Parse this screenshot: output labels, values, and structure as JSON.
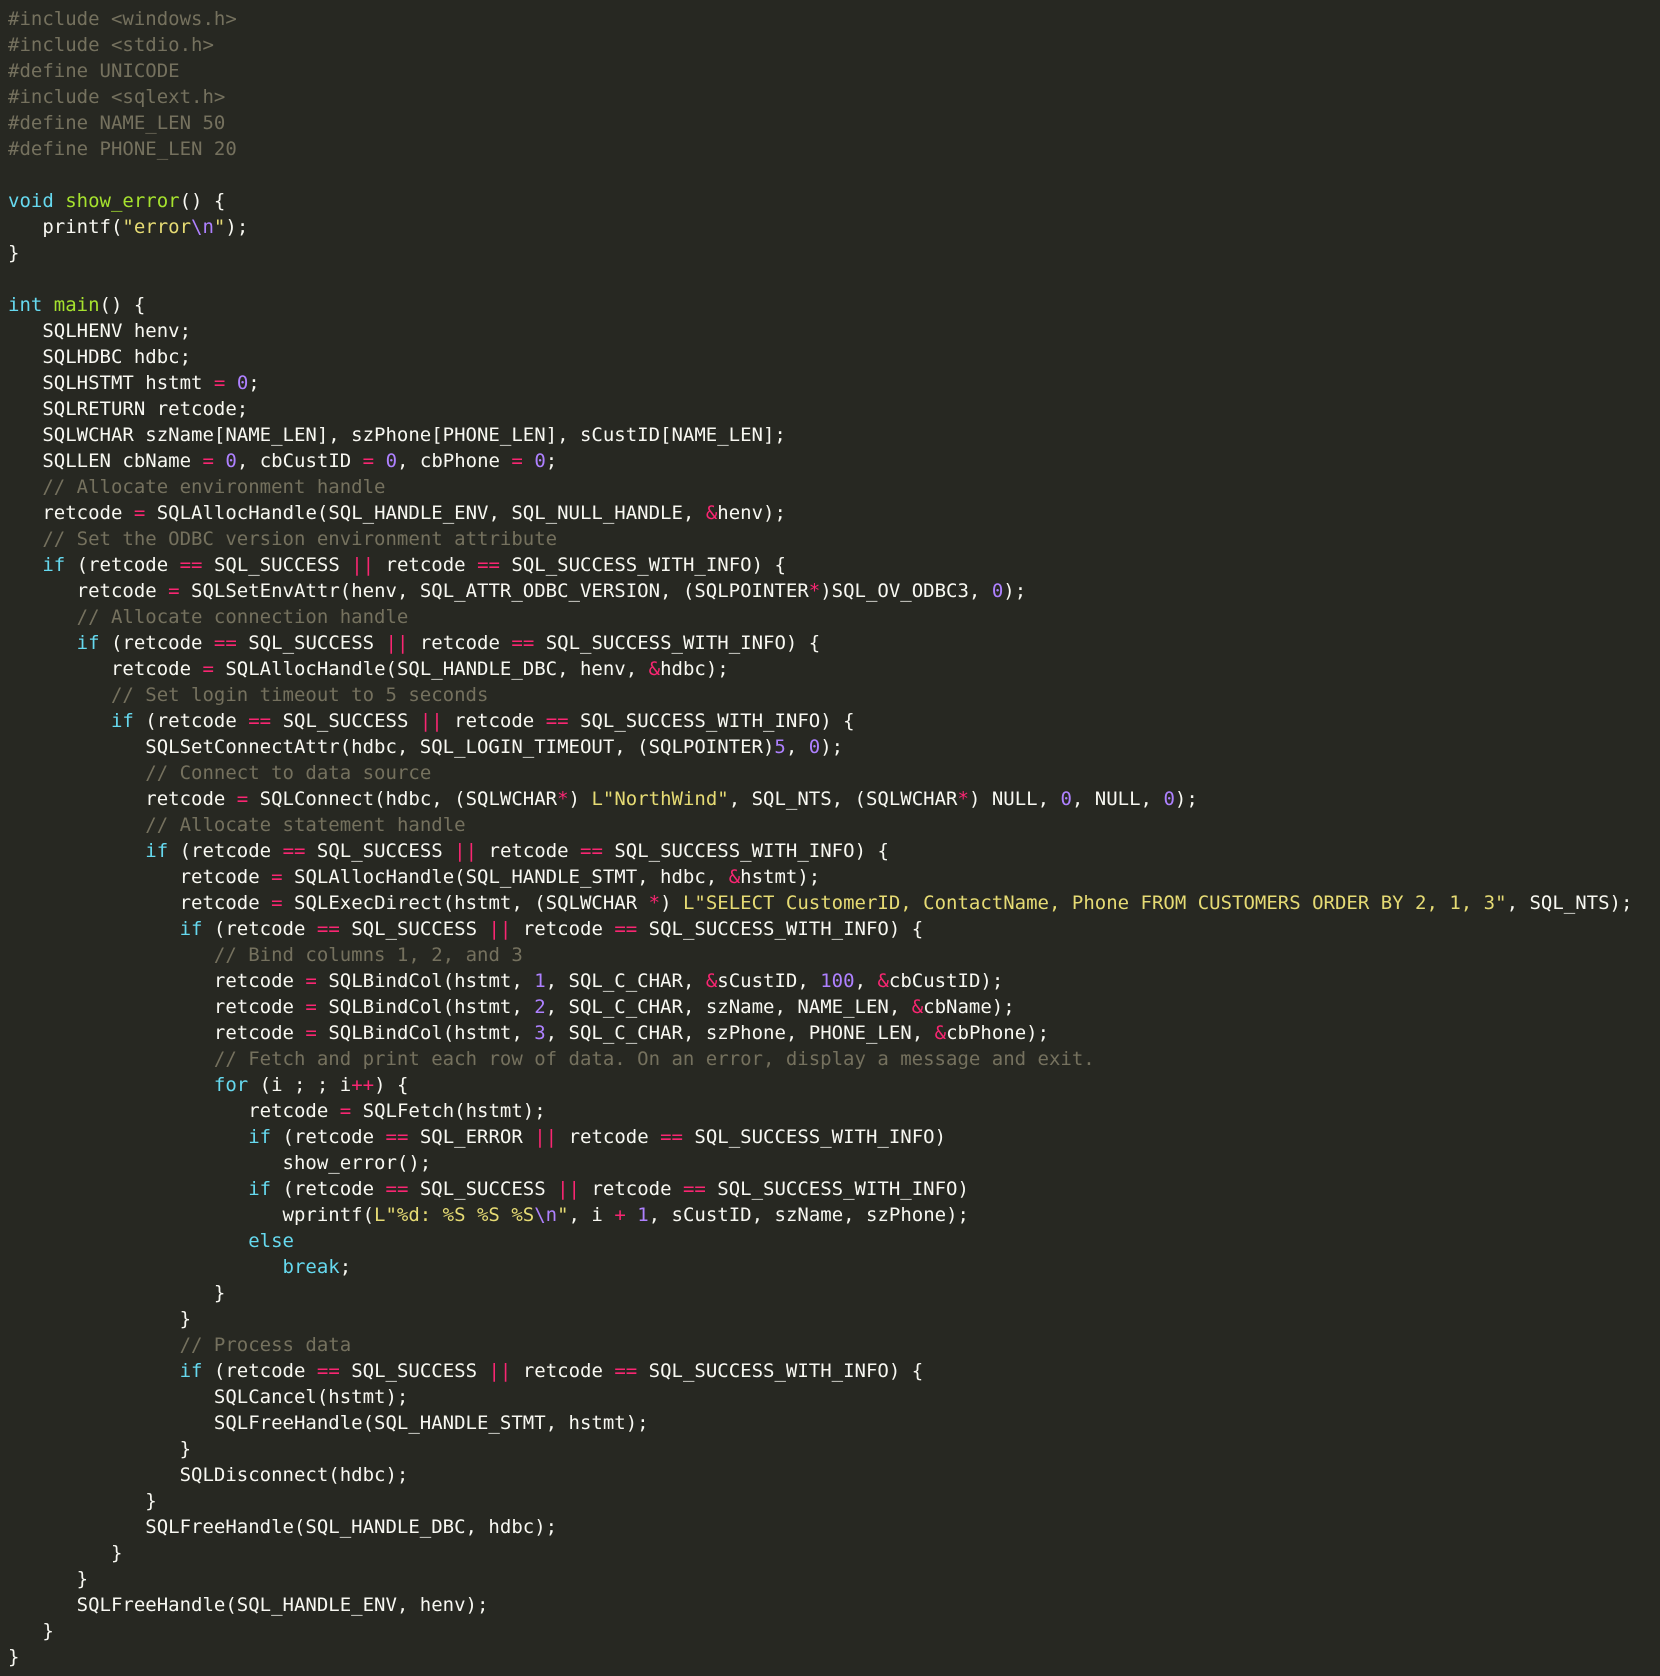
{
  "colors": {
    "background": "#272822",
    "text": "#f8f8f2",
    "comment": "#75715e",
    "keyword": "#66d9ef",
    "function": "#a6e22e",
    "operator": "#f92672",
    "number": "#ae81ff",
    "string": "#e6db74",
    "escape": "#ae81ff"
  },
  "code": {
    "lines": [
      [
        [
          "c",
          "#include <windows.h>"
        ]
      ],
      [
        [
          "c",
          "#include <stdio.h>"
        ]
      ],
      [
        [
          "c",
          "#define UNICODE"
        ]
      ],
      [
        [
          "c",
          "#include <sqlext.h>"
        ]
      ],
      [
        [
          "c",
          "#define NAME_LEN 50"
        ]
      ],
      [
        [
          "c",
          "#define PHONE_LEN 20"
        ]
      ],
      [],
      [
        [
          "k",
          "void"
        ],
        [
          "t",
          " "
        ],
        [
          "f",
          "show_error"
        ],
        [
          "t",
          "() {"
        ]
      ],
      [
        [
          "t",
          "   printf("
        ],
        [
          "s",
          "\"error"
        ],
        [
          "e",
          "\\n"
        ],
        [
          "s",
          "\""
        ],
        [
          "t",
          ");"
        ]
      ],
      [
        [
          "t",
          "}"
        ]
      ],
      [],
      [
        [
          "k",
          "int"
        ],
        [
          "t",
          " "
        ],
        [
          "f",
          "main"
        ],
        [
          "t",
          "() {"
        ]
      ],
      [
        [
          "t",
          "   SQLHENV henv;"
        ]
      ],
      [
        [
          "t",
          "   SQLHDBC hdbc;"
        ]
      ],
      [
        [
          "t",
          "   SQLHSTMT hstmt "
        ],
        [
          "o",
          "="
        ],
        [
          "t",
          " "
        ],
        [
          "n",
          "0"
        ],
        [
          "t",
          ";"
        ]
      ],
      [
        [
          "t",
          "   SQLRETURN retcode;"
        ]
      ],
      [
        [
          "t",
          "   SQLWCHAR szName[NAME_LEN], szPhone[PHONE_LEN], sCustID[NAME_LEN];"
        ]
      ],
      [
        [
          "t",
          "   SQLLEN cbName "
        ],
        [
          "o",
          "="
        ],
        [
          "t",
          " "
        ],
        [
          "n",
          "0"
        ],
        [
          "t",
          ", cbCustID "
        ],
        [
          "o",
          "="
        ],
        [
          "t",
          " "
        ],
        [
          "n",
          "0"
        ],
        [
          "t",
          ", cbPhone "
        ],
        [
          "o",
          "="
        ],
        [
          "t",
          " "
        ],
        [
          "n",
          "0"
        ],
        [
          "t",
          ";"
        ]
      ],
      [
        [
          "t",
          "   "
        ],
        [
          "c",
          "// Allocate environment handle"
        ]
      ],
      [
        [
          "t",
          "   retcode "
        ],
        [
          "o",
          "="
        ],
        [
          "t",
          " SQLAllocHandle(SQL_HANDLE_ENV, SQL_NULL_HANDLE, "
        ],
        [
          "o",
          "&"
        ],
        [
          "t",
          "henv);"
        ]
      ],
      [
        [
          "t",
          "   "
        ],
        [
          "c",
          "// Set the ODBC version environment attribute"
        ]
      ],
      [
        [
          "t",
          "   "
        ],
        [
          "k",
          "if"
        ],
        [
          "t",
          " (retcode "
        ],
        [
          "o",
          "=="
        ],
        [
          "t",
          " SQL_SUCCESS "
        ],
        [
          "o",
          "||"
        ],
        [
          "t",
          " retcode "
        ],
        [
          "o",
          "=="
        ],
        [
          "t",
          " SQL_SUCCESS_WITH_INFO) {"
        ]
      ],
      [
        [
          "t",
          "      retcode "
        ],
        [
          "o",
          "="
        ],
        [
          "t",
          " SQLSetEnvAttr(henv, SQL_ATTR_ODBC_VERSION, (SQLPOINTER"
        ],
        [
          "o",
          "*"
        ],
        [
          "t",
          ")SQL_OV_ODBC3, "
        ],
        [
          "n",
          "0"
        ],
        [
          "t",
          ");"
        ]
      ],
      [
        [
          "t",
          "      "
        ],
        [
          "c",
          "// Allocate connection handle"
        ]
      ],
      [
        [
          "t",
          "      "
        ],
        [
          "k",
          "if"
        ],
        [
          "t",
          " (retcode "
        ],
        [
          "o",
          "=="
        ],
        [
          "t",
          " SQL_SUCCESS "
        ],
        [
          "o",
          "||"
        ],
        [
          "t",
          " retcode "
        ],
        [
          "o",
          "=="
        ],
        [
          "t",
          " SQL_SUCCESS_WITH_INFO) {"
        ]
      ],
      [
        [
          "t",
          "         retcode "
        ],
        [
          "o",
          "="
        ],
        [
          "t",
          " SQLAllocHandle(SQL_HANDLE_DBC, henv, "
        ],
        [
          "o",
          "&"
        ],
        [
          "t",
          "hdbc);"
        ]
      ],
      [
        [
          "t",
          "         "
        ],
        [
          "c",
          "// Set login timeout to 5 seconds"
        ]
      ],
      [
        [
          "t",
          "         "
        ],
        [
          "k",
          "if"
        ],
        [
          "t",
          " (retcode "
        ],
        [
          "o",
          "=="
        ],
        [
          "t",
          " SQL_SUCCESS "
        ],
        [
          "o",
          "||"
        ],
        [
          "t",
          " retcode "
        ],
        [
          "o",
          "=="
        ],
        [
          "t",
          " SQL_SUCCESS_WITH_INFO) {"
        ]
      ],
      [
        [
          "t",
          "            SQLSetConnectAttr(hdbc, SQL_LOGIN_TIMEOUT, (SQLPOINTER)"
        ],
        [
          "n",
          "5"
        ],
        [
          "t",
          ", "
        ],
        [
          "n",
          "0"
        ],
        [
          "t",
          ");"
        ]
      ],
      [
        [
          "t",
          "            "
        ],
        [
          "c",
          "// Connect to data source"
        ]
      ],
      [
        [
          "t",
          "            retcode "
        ],
        [
          "o",
          "="
        ],
        [
          "t",
          " SQLConnect(hdbc, (SQLWCHAR"
        ],
        [
          "o",
          "*"
        ],
        [
          "t",
          ") "
        ],
        [
          "s",
          "L\"NorthWind\""
        ],
        [
          "t",
          ", SQL_NTS, (SQLWCHAR"
        ],
        [
          "o",
          "*"
        ],
        [
          "t",
          ") NULL, "
        ],
        [
          "n",
          "0"
        ],
        [
          "t",
          ", NULL, "
        ],
        [
          "n",
          "0"
        ],
        [
          "t",
          ");"
        ]
      ],
      [
        [
          "t",
          "            "
        ],
        [
          "c",
          "// Allocate statement handle"
        ]
      ],
      [
        [
          "t",
          "            "
        ],
        [
          "k",
          "if"
        ],
        [
          "t",
          " (retcode "
        ],
        [
          "o",
          "=="
        ],
        [
          "t",
          " SQL_SUCCESS "
        ],
        [
          "o",
          "||"
        ],
        [
          "t",
          " retcode "
        ],
        [
          "o",
          "=="
        ],
        [
          "t",
          " SQL_SUCCESS_WITH_INFO) {"
        ]
      ],
      [
        [
          "t",
          "               retcode "
        ],
        [
          "o",
          "="
        ],
        [
          "t",
          " SQLAllocHandle(SQL_HANDLE_STMT, hdbc, "
        ],
        [
          "o",
          "&"
        ],
        [
          "t",
          "hstmt);"
        ]
      ],
      [
        [
          "t",
          "               retcode "
        ],
        [
          "o",
          "="
        ],
        [
          "t",
          " SQLExecDirect(hstmt, (SQLWCHAR "
        ],
        [
          "o",
          "*"
        ],
        [
          "t",
          ") "
        ],
        [
          "s",
          "L\"SELECT CustomerID, ContactName, Phone FROM CUSTOMERS ORDER BY 2, 1, 3\""
        ],
        [
          "t",
          ", SQL_NTS);"
        ]
      ],
      [
        [
          "t",
          "               "
        ],
        [
          "k",
          "if"
        ],
        [
          "t",
          " (retcode "
        ],
        [
          "o",
          "=="
        ],
        [
          "t",
          " SQL_SUCCESS "
        ],
        [
          "o",
          "||"
        ],
        [
          "t",
          " retcode "
        ],
        [
          "o",
          "=="
        ],
        [
          "t",
          " SQL_SUCCESS_WITH_INFO) {"
        ]
      ],
      [
        [
          "t",
          "                  "
        ],
        [
          "c",
          "// Bind columns 1, 2, and 3"
        ]
      ],
      [
        [
          "t",
          "                  retcode "
        ],
        [
          "o",
          "="
        ],
        [
          "t",
          " SQLBindCol(hstmt, "
        ],
        [
          "n",
          "1"
        ],
        [
          "t",
          ", SQL_C_CHAR, "
        ],
        [
          "o",
          "&"
        ],
        [
          "t",
          "sCustID, "
        ],
        [
          "n",
          "100"
        ],
        [
          "t",
          ", "
        ],
        [
          "o",
          "&"
        ],
        [
          "t",
          "cbCustID);"
        ]
      ],
      [
        [
          "t",
          "                  retcode "
        ],
        [
          "o",
          "="
        ],
        [
          "t",
          " SQLBindCol(hstmt, "
        ],
        [
          "n",
          "2"
        ],
        [
          "t",
          ", SQL_C_CHAR, szName, NAME_LEN, "
        ],
        [
          "o",
          "&"
        ],
        [
          "t",
          "cbName);"
        ]
      ],
      [
        [
          "t",
          "                  retcode "
        ],
        [
          "o",
          "="
        ],
        [
          "t",
          " SQLBindCol(hstmt, "
        ],
        [
          "n",
          "3"
        ],
        [
          "t",
          ", SQL_C_CHAR, szPhone, PHONE_LEN, "
        ],
        [
          "o",
          "&"
        ],
        [
          "t",
          "cbPhone);"
        ]
      ],
      [
        [
          "t",
          "                  "
        ],
        [
          "c",
          "// Fetch and print each row of data. On an error, display a message and exit."
        ]
      ],
      [
        [
          "t",
          "                  "
        ],
        [
          "k",
          "for"
        ],
        [
          "t",
          " (i ; ; i"
        ],
        [
          "o",
          "++"
        ],
        [
          "t",
          ") {"
        ]
      ],
      [
        [
          "t",
          "                     retcode "
        ],
        [
          "o",
          "="
        ],
        [
          "t",
          " SQLFetch(hstmt);"
        ]
      ],
      [
        [
          "t",
          "                     "
        ],
        [
          "k",
          "if"
        ],
        [
          "t",
          " (retcode "
        ],
        [
          "o",
          "=="
        ],
        [
          "t",
          " SQL_ERROR "
        ],
        [
          "o",
          "||"
        ],
        [
          "t",
          " retcode "
        ],
        [
          "o",
          "=="
        ],
        [
          "t",
          " SQL_SUCCESS_WITH_INFO)"
        ]
      ],
      [
        [
          "t",
          "                        show_error();"
        ]
      ],
      [
        [
          "t",
          "                     "
        ],
        [
          "k",
          "if"
        ],
        [
          "t",
          " (retcode "
        ],
        [
          "o",
          "=="
        ],
        [
          "t",
          " SQL_SUCCESS "
        ],
        [
          "o",
          "||"
        ],
        [
          "t",
          " retcode "
        ],
        [
          "o",
          "=="
        ],
        [
          "t",
          " SQL_SUCCESS_WITH_INFO)"
        ]
      ],
      [
        [
          "t",
          "                        wprintf("
        ],
        [
          "s",
          "L\"%d: %S %S %S"
        ],
        [
          "e",
          "\\n"
        ],
        [
          "s",
          "\""
        ],
        [
          "t",
          ", i "
        ],
        [
          "o",
          "+"
        ],
        [
          "t",
          " "
        ],
        [
          "n",
          "1"
        ],
        [
          "t",
          ", sCustID, szName, szPhone);"
        ]
      ],
      [
        [
          "t",
          "                     "
        ],
        [
          "k",
          "else"
        ]
      ],
      [
        [
          "t",
          "                        "
        ],
        [
          "k",
          "break"
        ],
        [
          "t",
          ";"
        ]
      ],
      [
        [
          "t",
          "                  }"
        ]
      ],
      [
        [
          "t",
          "               }"
        ]
      ],
      [
        [
          "t",
          "               "
        ],
        [
          "c",
          "// Process data"
        ]
      ],
      [
        [
          "t",
          "               "
        ],
        [
          "k",
          "if"
        ],
        [
          "t",
          " (retcode "
        ],
        [
          "o",
          "=="
        ],
        [
          "t",
          " SQL_SUCCESS "
        ],
        [
          "o",
          "||"
        ],
        [
          "t",
          " retcode "
        ],
        [
          "o",
          "=="
        ],
        [
          "t",
          " SQL_SUCCESS_WITH_INFO) {"
        ]
      ],
      [
        [
          "t",
          "                  SQLCancel(hstmt);"
        ]
      ],
      [
        [
          "t",
          "                  SQLFreeHandle(SQL_HANDLE_STMT, hstmt);"
        ]
      ],
      [
        [
          "t",
          "               }"
        ]
      ],
      [
        [
          "t",
          "               SQLDisconnect(hdbc);"
        ]
      ],
      [
        [
          "t",
          "            }"
        ]
      ],
      [
        [
          "t",
          "            SQLFreeHandle(SQL_HANDLE_DBC, hdbc);"
        ]
      ],
      [
        [
          "t",
          "         }"
        ]
      ],
      [
        [
          "t",
          "      }"
        ]
      ],
      [
        [
          "t",
          "      SQLFreeHandle(SQL_HANDLE_ENV, henv);"
        ]
      ],
      [
        [
          "t",
          "   }"
        ]
      ],
      [
        [
          "t",
          "}"
        ]
      ]
    ]
  }
}
